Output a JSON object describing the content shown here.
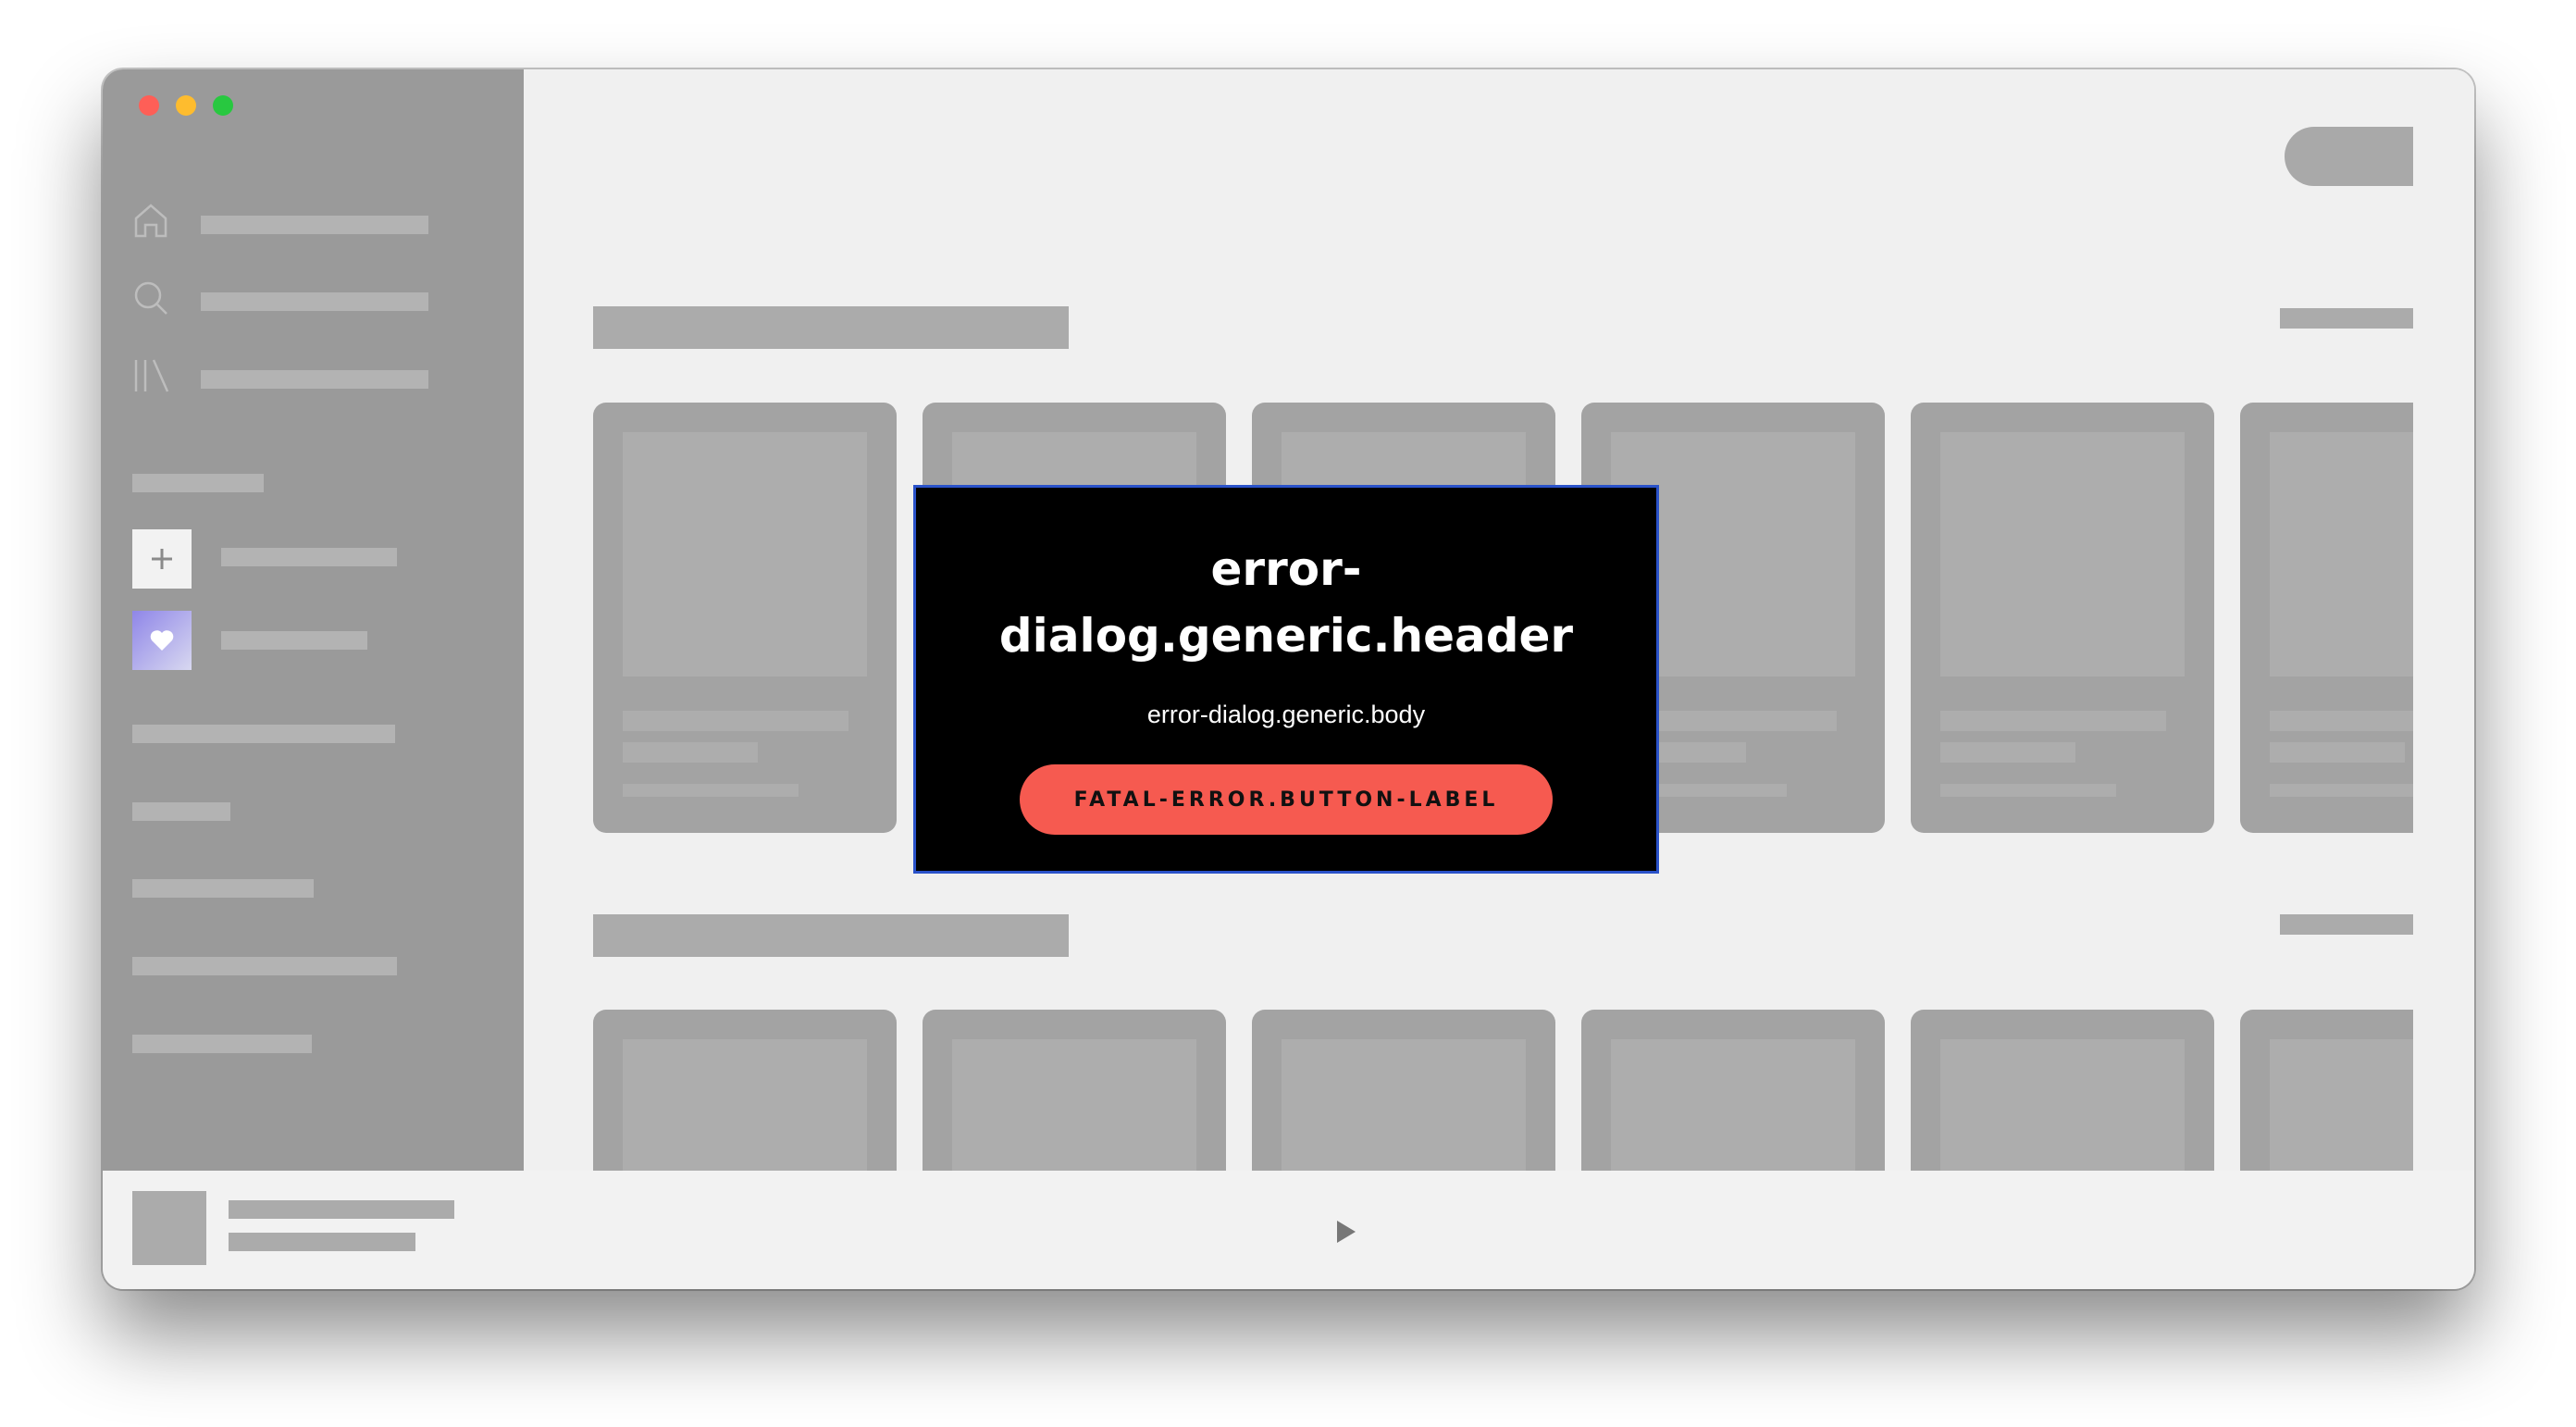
{
  "dialog": {
    "header": "error-dialog.generic.header",
    "body": "error-dialog.generic.body",
    "button_label": "FATAL-ERROR.BUTTON-LABEL"
  },
  "colors": {
    "dialog_background": "#000000",
    "dialog_border": "#2a52c9",
    "button": "#f65a50",
    "skeleton": "#a3a3a3",
    "sidebar": "#9a9a9a"
  },
  "icons": {
    "sidebar_nav": [
      "home-icon",
      "search-icon",
      "library-icon"
    ],
    "create_playlist": "plus-icon",
    "liked_songs": "heart-icon",
    "player": "play-icon"
  }
}
